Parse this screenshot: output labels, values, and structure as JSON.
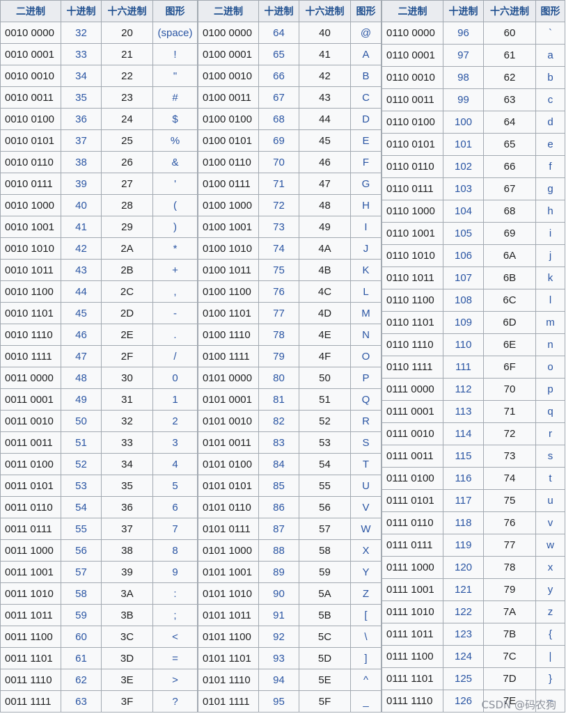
{
  "headers": [
    "二进制",
    "十进制",
    "十六进制",
    "图形"
  ],
  "columns": [
    {
      "rows": [
        [
          "0010 0000",
          "32",
          "20",
          "(space)"
        ],
        [
          "0010 0001",
          "33",
          "21",
          "!"
        ],
        [
          "0010 0010",
          "34",
          "22",
          "\""
        ],
        [
          "0010 0011",
          "35",
          "23",
          "#"
        ],
        [
          "0010 0100",
          "36",
          "24",
          "$"
        ],
        [
          "0010 0101",
          "37",
          "25",
          "%"
        ],
        [
          "0010 0110",
          "38",
          "26",
          "&"
        ],
        [
          "0010 0111",
          "39",
          "27",
          "'"
        ],
        [
          "0010 1000",
          "40",
          "28",
          "("
        ],
        [
          "0010 1001",
          "41",
          "29",
          ")"
        ],
        [
          "0010 1010",
          "42",
          "2A",
          "*"
        ],
        [
          "0010 1011",
          "43",
          "2B",
          "+"
        ],
        [
          "0010 1100",
          "44",
          "2C",
          ","
        ],
        [
          "0010 1101",
          "45",
          "2D",
          "-"
        ],
        [
          "0010 1110",
          "46",
          "2E",
          "."
        ],
        [
          "0010 1111",
          "47",
          "2F",
          "/"
        ],
        [
          "0011 0000",
          "48",
          "30",
          "0"
        ],
        [
          "0011 0001",
          "49",
          "31",
          "1"
        ],
        [
          "0011 0010",
          "50",
          "32",
          "2"
        ],
        [
          "0011 0011",
          "51",
          "33",
          "3"
        ],
        [
          "0011 0100",
          "52",
          "34",
          "4"
        ],
        [
          "0011 0101",
          "53",
          "35",
          "5"
        ],
        [
          "0011 0110",
          "54",
          "36",
          "6"
        ],
        [
          "0011 0111",
          "55",
          "37",
          "7"
        ],
        [
          "0011 1000",
          "56",
          "38",
          "8"
        ],
        [
          "0011 1001",
          "57",
          "39",
          "9"
        ],
        [
          "0011 1010",
          "58",
          "3A",
          ":"
        ],
        [
          "0011 1011",
          "59",
          "3B",
          ";"
        ],
        [
          "0011 1100",
          "60",
          "3C",
          "<"
        ],
        [
          "0011 1101",
          "61",
          "3D",
          "="
        ],
        [
          "0011 1110",
          "62",
          "3E",
          ">"
        ],
        [
          "0011 1111",
          "63",
          "3F",
          "?"
        ]
      ]
    },
    {
      "rows": [
        [
          "0100 0000",
          "64",
          "40",
          "@"
        ],
        [
          "0100 0001",
          "65",
          "41",
          "A"
        ],
        [
          "0100 0010",
          "66",
          "42",
          "B"
        ],
        [
          "0100 0011",
          "67",
          "43",
          "C"
        ],
        [
          "0100 0100",
          "68",
          "44",
          "D"
        ],
        [
          "0100 0101",
          "69",
          "45",
          "E"
        ],
        [
          "0100 0110",
          "70",
          "46",
          "F"
        ],
        [
          "0100 0111",
          "71",
          "47",
          "G"
        ],
        [
          "0100 1000",
          "72",
          "48",
          "H"
        ],
        [
          "0100 1001",
          "73",
          "49",
          "I"
        ],
        [
          "0100 1010",
          "74",
          "4A",
          "J"
        ],
        [
          "0100 1011",
          "75",
          "4B",
          "K"
        ],
        [
          "0100 1100",
          "76",
          "4C",
          "L"
        ],
        [
          "0100 1101",
          "77",
          "4D",
          "M"
        ],
        [
          "0100 1110",
          "78",
          "4E",
          "N"
        ],
        [
          "0100 1111",
          "79",
          "4F",
          "O"
        ],
        [
          "0101 0000",
          "80",
          "50",
          "P"
        ],
        [
          "0101 0001",
          "81",
          "51",
          "Q"
        ],
        [
          "0101 0010",
          "82",
          "52",
          "R"
        ],
        [
          "0101 0011",
          "83",
          "53",
          "S"
        ],
        [
          "0101 0100",
          "84",
          "54",
          "T"
        ],
        [
          "0101 0101",
          "85",
          "55",
          "U"
        ],
        [
          "0101 0110",
          "86",
          "56",
          "V"
        ],
        [
          "0101 0111",
          "87",
          "57",
          "W"
        ],
        [
          "0101 1000",
          "88",
          "58",
          "X"
        ],
        [
          "0101 1001",
          "89",
          "59",
          "Y"
        ],
        [
          "0101 1010",
          "90",
          "5A",
          "Z"
        ],
        [
          "0101 1011",
          "91",
          "5B",
          "["
        ],
        [
          "0101 1100",
          "92",
          "5C",
          "\\"
        ],
        [
          "0101 1101",
          "93",
          "5D",
          "]"
        ],
        [
          "0101 1110",
          "94",
          "5E",
          "^"
        ],
        [
          "0101 1111",
          "95",
          "5F",
          "_"
        ]
      ]
    },
    {
      "rows": [
        [
          "0110 0000",
          "96",
          "60",
          "`"
        ],
        [
          "0110 0001",
          "97",
          "61",
          "a"
        ],
        [
          "0110 0010",
          "98",
          "62",
          "b"
        ],
        [
          "0110 0011",
          "99",
          "63",
          "c"
        ],
        [
          "0110 0100",
          "100",
          "64",
          "d"
        ],
        [
          "0110 0101",
          "101",
          "65",
          "e"
        ],
        [
          "0110 0110",
          "102",
          "66",
          "f"
        ],
        [
          "0110 0111",
          "103",
          "67",
          "g"
        ],
        [
          "0110 1000",
          "104",
          "68",
          "h"
        ],
        [
          "0110 1001",
          "105",
          "69",
          "i"
        ],
        [
          "0110 1010",
          "106",
          "6A",
          "j"
        ],
        [
          "0110 1011",
          "107",
          "6B",
          "k"
        ],
        [
          "0110 1100",
          "108",
          "6C",
          "l"
        ],
        [
          "0110 1101",
          "109",
          "6D",
          "m"
        ],
        [
          "0110 1110",
          "110",
          "6E",
          "n"
        ],
        [
          "0110 1111",
          "111",
          "6F",
          "o"
        ],
        [
          "0111 0000",
          "112",
          "70",
          "p"
        ],
        [
          "0111 0001",
          "113",
          "71",
          "q"
        ],
        [
          "0111 0010",
          "114",
          "72",
          "r"
        ],
        [
          "0111 0011",
          "115",
          "73",
          "s"
        ],
        [
          "0111 0100",
          "116",
          "74",
          "t"
        ],
        [
          "0111 0101",
          "117",
          "75",
          "u"
        ],
        [
          "0111 0110",
          "118",
          "76",
          "v"
        ],
        [
          "0111 0111",
          "119",
          "77",
          "w"
        ],
        [
          "0111 1000",
          "120",
          "78",
          "x"
        ],
        [
          "0111 1001",
          "121",
          "79",
          "y"
        ],
        [
          "0111 1010",
          "122",
          "7A",
          "z"
        ],
        [
          "0111 1011",
          "123",
          "7B",
          "{"
        ],
        [
          "0111 1100",
          "124",
          "7C",
          "|"
        ],
        [
          "0111 1101",
          "125",
          "7D",
          "}"
        ],
        [
          "0111 1110",
          "126",
          "7E",
          "~"
        ]
      ]
    }
  ],
  "watermark": "CSDN @码农狗"
}
